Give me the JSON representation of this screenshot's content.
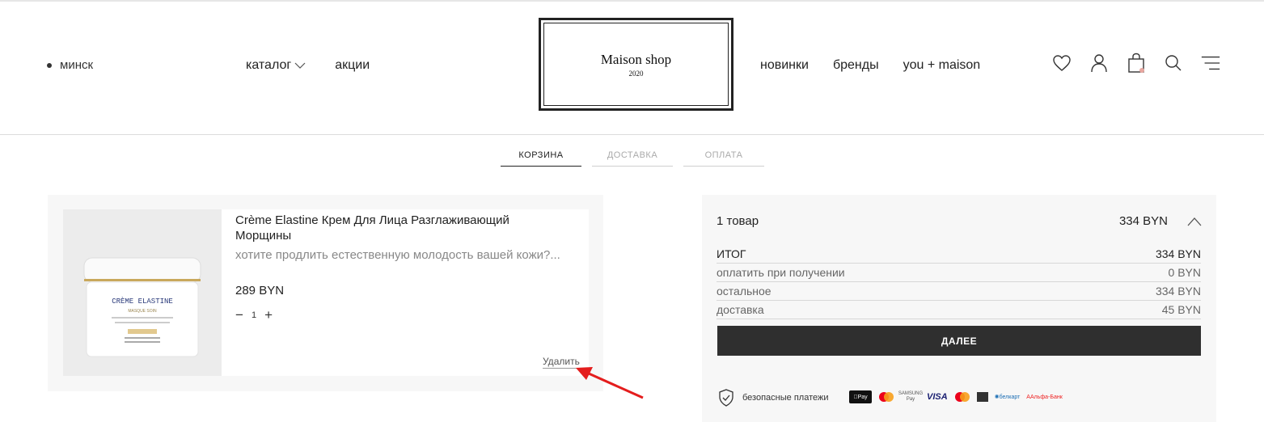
{
  "header": {
    "city": "минск",
    "nav_left": [
      "каталог",
      "акции"
    ],
    "nav_right": [
      "новинки",
      "бренды",
      "you + maison"
    ],
    "logo_title": "Maison shop",
    "logo_year": "2020",
    "icons": [
      "heart-icon",
      "user-icon",
      "bag-icon",
      "search-icon",
      "menu-icon"
    ]
  },
  "steps": [
    "КОРЗИНА",
    "ДОСТАВКА",
    "ОПЛАТА"
  ],
  "cart": {
    "product": {
      "name": "Crème Elastine Крем Для Лица Разглаживающий Морщины",
      "description": "хотите продлить естественную молодость вашей кожи?...",
      "price": "289 BYN",
      "quantity": "1",
      "image_label": "CRÈME ELASTINE",
      "image_sublabel": "MASQUE SOIN",
      "remove_label": "Удалить"
    }
  },
  "summary": {
    "count_label": "1 товар",
    "count_price": "334 BYN",
    "rows": [
      {
        "label": "ИТОГ",
        "value": "334 BYN"
      },
      {
        "label": "оплатить при получении",
        "value": "0 BYN"
      },
      {
        "label": "остальное",
        "value": "334 BYN"
      },
      {
        "label": "доставка",
        "value": "45 BYN"
      }
    ],
    "next_button": "ДАЛЕЕ",
    "secure_label": "безопасные платежи",
    "payment_methods": [
      "Pay",
      "SAMSUNG Pay",
      "VISA",
      "белкарт",
      "Альфа-Банк"
    ]
  },
  "colors": {
    "button_bg": "#2f2f2f",
    "panel_bg": "#f7f7f7",
    "annotation_arrow": "#e41d1d"
  }
}
